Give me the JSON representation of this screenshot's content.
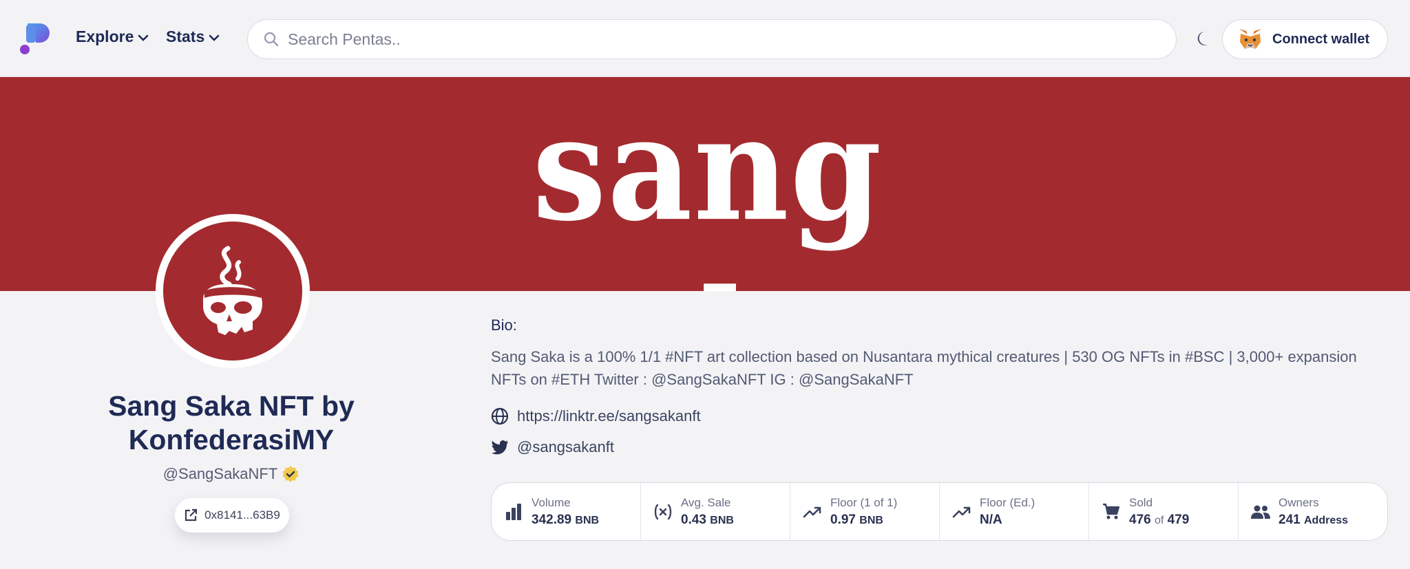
{
  "nav": {
    "explore": "Explore",
    "stats": "Stats"
  },
  "search": {
    "placeholder": "Search Pentas.."
  },
  "wallet": {
    "label": "Connect wallet"
  },
  "banner": {
    "title": "sang saka"
  },
  "profile": {
    "name": "Sang Saka NFT by KonfederasiMY",
    "handle": "@SangSakaNFT",
    "address": "0x8141...63B9"
  },
  "bio": {
    "label": "Bio:",
    "text": "Sang Saka is a 100% 1/1 #NFT art collection based on Nusantara mythical creatures | 530 OG NFTs in #BSC | 3,000+ expansion NFTs on #ETH Twitter : @SangSakaNFT IG : @SangSakaNFT",
    "website": "https://linktr.ee/sangsakanft",
    "twitter": "@sangsakanft"
  },
  "stats": {
    "volume": {
      "label": "Volume",
      "value": "342.89",
      "unit": "BNB"
    },
    "avg_sale": {
      "label": "Avg. Sale",
      "value": "0.43",
      "unit": "BNB"
    },
    "floor_1of1": {
      "label": "Floor (1 of 1)",
      "value": "0.97",
      "unit": "BNB"
    },
    "floor_ed": {
      "label": "Floor (Ed.)",
      "value": "N/A"
    },
    "sold": {
      "label": "Sold",
      "value": "476",
      "of": "of",
      "total": "479"
    },
    "owners": {
      "label": "Owners",
      "value": "241",
      "unit": "Address"
    }
  },
  "colors": {
    "brand_red": "#a32b2f",
    "text_navy": "#1f2a55",
    "background": "#f3f3f6",
    "verified_badge": "#f2c94c"
  },
  "icons": [
    "pentas-logo-icon",
    "chevron-down-icon",
    "search-icon",
    "moon-icon",
    "metamask-fox-icon",
    "skull-icon",
    "verified-icon",
    "external-link-icon",
    "globe-icon",
    "twitter-icon",
    "bar-chart-icon",
    "function-x-icon",
    "trending-up-icon",
    "cart-icon",
    "people-icon"
  ]
}
